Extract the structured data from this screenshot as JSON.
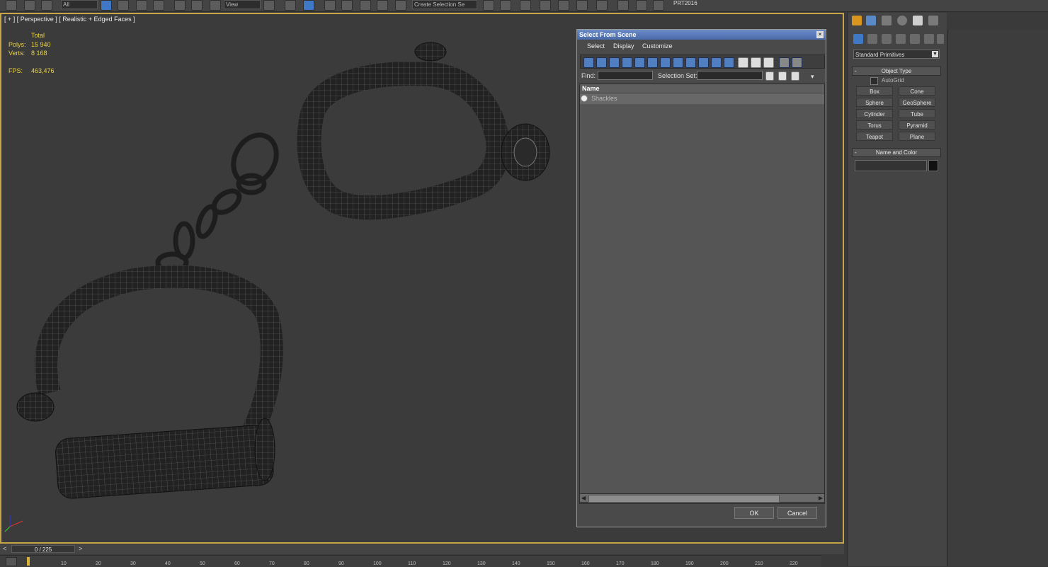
{
  "toolbar": {
    "selection_filter": "All",
    "ref_coord": "View",
    "named_selection_placeholder": "Create Selection Se",
    "workspace": "PRT2016"
  },
  "viewport": {
    "label": "[ + ] [ Perspective ] [ Realistic + Edged Faces ]",
    "stats": {
      "total_label": "Total",
      "polys_label": "Polys:",
      "polys_value": "15 940",
      "verts_label": "Verts:",
      "verts_value": "8 168",
      "fps_label": "FPS:",
      "fps_value": "463,476"
    }
  },
  "dialog": {
    "title": "Select From Scene",
    "menu": [
      "Select",
      "Display",
      "Customize"
    ],
    "find_label": "Find:",
    "selection_set_label": "Selection Set:",
    "list_header": "Name",
    "items": [
      "Shackles"
    ],
    "ok_label": "OK",
    "cancel_label": "Cancel"
  },
  "command_panel": {
    "dropdown_value": "Standard Primitives",
    "object_type_title": "Object Type",
    "autogrid_label": "AutoGrid",
    "primitives": [
      "Box",
      "Cone",
      "Sphere",
      "GeoSphere",
      "Cylinder",
      "Tube",
      "Torus",
      "Pyramid",
      "Teapot",
      "Plane"
    ],
    "name_color_title": "Name and Color"
  },
  "timeline": {
    "frame_display": "0 / 225",
    "ticks": [
      "10",
      "20",
      "30",
      "40",
      "50",
      "60",
      "70",
      "80",
      "90",
      "100",
      "110",
      "120",
      "130",
      "140",
      "150",
      "160",
      "170",
      "180",
      "190",
      "200",
      "210",
      "220"
    ]
  }
}
